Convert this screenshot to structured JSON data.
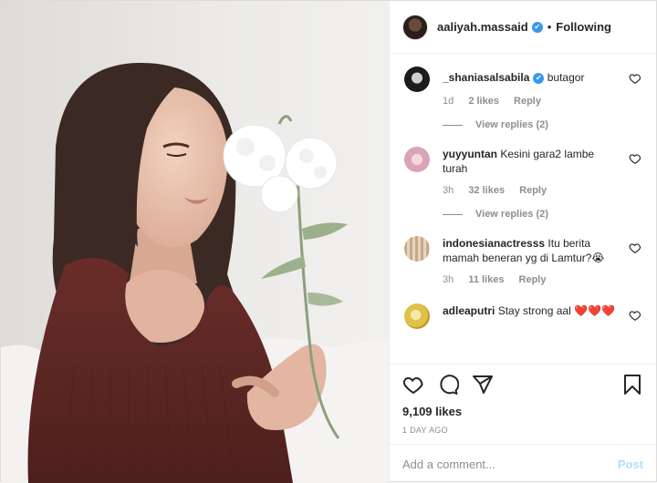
{
  "header": {
    "username": "aaliyah.massaid",
    "verified_glyph": "✔",
    "separator": "•",
    "follow_status": "Following",
    "more_icon": "more-icon"
  },
  "comments": [
    {
      "username": "_shaniasalsabila",
      "verified": true,
      "text": "butagor",
      "time": "1d",
      "likes": "2 likes",
      "reply": "Reply",
      "view_replies": "View replies (2)",
      "avatar_color": "#1a1a1a"
    },
    {
      "username": "yuyyuntan",
      "verified": false,
      "text": "Kesini gara2 lambe turah",
      "time": "3h",
      "likes": "32 likes",
      "reply": "Reply",
      "view_replies": "View replies (2)",
      "avatar_color": "#d9a3b9"
    },
    {
      "username": "indonesianactresss",
      "verified": false,
      "text": "Itu berita mamah beneran yg di Lamtur?😭",
      "time": "3h",
      "likes": "11 likes",
      "reply": "Reply",
      "avatar_color": "#c7a98a"
    },
    {
      "username": "adleaputri",
      "verified": false,
      "text": "Stay strong aal ❤️❤️❤️",
      "avatar_color": "#e0c24a"
    }
  ],
  "actions": {
    "like_icon": "heart-icon",
    "comment_icon": "comment-icon",
    "share_icon": "share-icon",
    "save_icon": "bookmark-icon",
    "likes": "9,109 likes",
    "date": "1 DAY AGO"
  },
  "add_comment": {
    "placeholder": "Add a comment...",
    "post_label": "Post"
  },
  "colors": {
    "sweater": "#5a2623",
    "hair": "#3a2a22",
    "wall": "#e9e7e4",
    "accent": "#3897f0",
    "post_button_disabled": "#b2dffc"
  }
}
